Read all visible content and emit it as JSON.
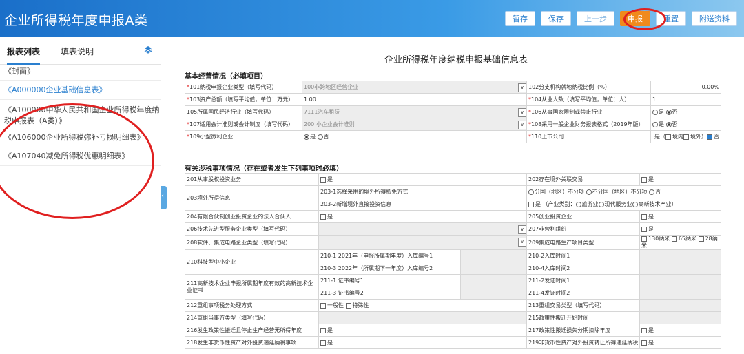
{
  "header": {
    "title": "企业所得税年度申报A类",
    "buttons": [
      "暂存",
      "保存",
      "上一步",
      "申报",
      "重置",
      "附送资料"
    ]
  },
  "sidebar": {
    "tabs": [
      "报表列表",
      "填表说明"
    ],
    "items": [
      "《封面》",
      "《A000000企业基础信息表》",
      "《A100000中华人民共和国企业所得税年度纳",
      "税申报表（A类）》",
      "《A106000企业所得税弥补亏损明细表》",
      "《A107040减免所得税优惠明细表》"
    ]
  },
  "main": {
    "form_title": "企业所得税年度纳税申报基础信息表",
    "section1": "基本经营情况（必填项目）",
    "section2": "有关涉税事项情况（存在或者发生下列事项时必填）",
    "basic": {
      "r101": "101纳税申报企业类型（填写代码）",
      "r101_val": "100非跨地区经营企业",
      "r102": "102分支机构就地纳税比例（%）",
      "r102_val": "0.00%",
      "r103": "103资产总额（填写平均值，单位：万元）",
      "r103_val": "1.00",
      "r104": "104从业人数（填写平均值，单位：人）",
      "r104_val": "1",
      "r105": "105所属国民经济行业（填写代码）",
      "r105_val": "7111汽车租赁",
      "r106": "106从事国家限制或禁止行业",
      "r107": "107适用会计准则或会计制度（填写代码）",
      "r107_val": "200 小企业会计准则",
      "r108": "108采用一般企业财务报表格式（2019年版）",
      "r109": "109小型微利企业",
      "r110": "110上市公司",
      "yes": "是",
      "no": "否",
      "r110_a": "是（",
      "r110_b": "境内",
      "r110_c": "境外）",
      "r110_d": "否"
    },
    "tax": {
      "r201": "201从事股权投资业务",
      "r202": "202存在境外关联交易",
      "r203": "203境外所得信息",
      "r203_1": "203-1选择采用的境外所得抵免方式",
      "r203_1_a": "分国（地区）不分项",
      "r203_1_b": "不分国（地区）不分项",
      "r203_1_c": "否",
      "r203_2": "203-2新增境外直接投资信息",
      "r203_2_a": "是 （产业类别：",
      "r203_2_b": "旅游业",
      "r203_2_c": "现代服务业",
      "r203_2_d": "高新技术产业）",
      "r204": "204有限合伙制创业投资企业的法人合伙人",
      "r205": "205创业投资企业",
      "r206": "206技术先进型服务企业类型（填写代码）",
      "r207": "207非营利组织",
      "r208": "208软件、集成电路企业类型（填写代码）",
      "r209": "209集成电路生产项目类型",
      "r209_a": "130纳米",
      "r209_b": "65纳米",
      "r209_c": "28纳",
      "r209_d": "米",
      "r210": "210科技型中小企业",
      "r210_1": "210-1  2021年（申报所属期年度）入库编号1",
      "r210_2": "210-2入库时间1",
      "r210_3": "210-3  2022年（所属期下一年度）入库编号2",
      "r210_4": "210-4入库时间2",
      "r211": "211高新技术企业申报所属期年度有效的高新技术企业证书",
      "r211_1": "211-1 证书编号1",
      "r211_2": "211-2发证时间1",
      "r211_3": "211-3 证书编号2",
      "r211_4": "211-4发证时间2",
      "r212": "212重组事项税务处理方式",
      "r212_a": "一般性",
      "r212_b": "特殊性",
      "r213": "213重组交易类型（填写代码）",
      "r214": "214重组当事方类型（填写代码）",
      "r215": "215政策性搬迁开始时间",
      "r216": "216发生政策性搬迁且停止生产经营无所得年度",
      "r217": "217政策性搬迁损失分期扣除年度",
      "r218": "218发生非货币性资产对外投资递延纳税事项",
      "r219": "219非货币性资产对外投资转让所得递延纳税"
    }
  },
  "colors": {
    "header": "#1a6fc9",
    "primary_button": "#f08a1c",
    "annotation": "#e02020",
    "link": "#2a7fcf"
  }
}
